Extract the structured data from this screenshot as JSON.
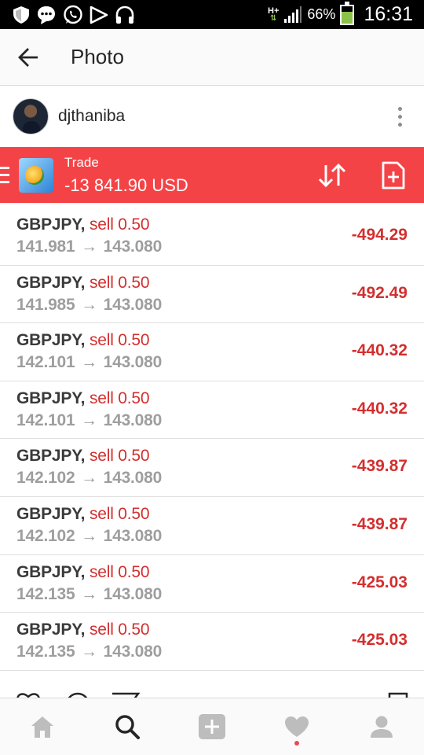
{
  "status_bar": {
    "network_type": "H+",
    "battery_percent": "66%",
    "battery_level": 0.66,
    "time": "16:31",
    "icons": [
      "shield-icon",
      "message-icon",
      "whatsapp-icon",
      "play-icon",
      "headphones-icon",
      "data-arrows-icon",
      "signal-icon",
      "battery-icon"
    ]
  },
  "app_bar": {
    "title": "Photo"
  },
  "post": {
    "username": "djthaniba"
  },
  "trade_banner": {
    "label": "Trade",
    "balance": "-13 841.90 USD",
    "background_color": "#f44346"
  },
  "trades": [
    {
      "symbol": "GBPJPY,",
      "side": "sell 0.50",
      "open": "141.981",
      "arrow": "→",
      "current": "143.080",
      "profit": "-494.29"
    },
    {
      "symbol": "GBPJPY,",
      "side": "sell 0.50",
      "open": "141.985",
      "arrow": "→",
      "current": "143.080",
      "profit": "-492.49"
    },
    {
      "symbol": "GBPJPY,",
      "side": "sell 0.50",
      "open": "142.101",
      "arrow": "→",
      "current": "143.080",
      "profit": "-440.32"
    },
    {
      "symbol": "GBPJPY,",
      "side": "sell 0.50",
      "open": "142.101",
      "arrow": "→",
      "current": "143.080",
      "profit": "-440.32"
    },
    {
      "symbol": "GBPJPY,",
      "side": "sell 0.50",
      "open": "142.102",
      "arrow": "→",
      "current": "143.080",
      "profit": "-439.87"
    },
    {
      "symbol": "GBPJPY,",
      "side": "sell 0.50",
      "open": "142.102",
      "arrow": "→",
      "current": "143.080",
      "profit": "-439.87"
    },
    {
      "symbol": "GBPJPY,",
      "side": "sell 0.50",
      "open": "142.135",
      "arrow": "→",
      "current": "143.080",
      "profit": "-425.03"
    },
    {
      "symbol": "GBPJPY,",
      "side": "sell 0.50",
      "open": "142.135",
      "arrow": "→",
      "current": "143.080",
      "profit": "-425.03"
    }
  ],
  "colors": {
    "loss": "#d32f2f",
    "price_gray": "#9e9e9e",
    "symbol_dark": "#3a3a3a",
    "notification": "#ed4956"
  },
  "bottom_nav": {
    "items": [
      "home-icon",
      "search-icon",
      "add-icon",
      "heart-icon",
      "profile-icon"
    ],
    "active": "search-icon"
  }
}
